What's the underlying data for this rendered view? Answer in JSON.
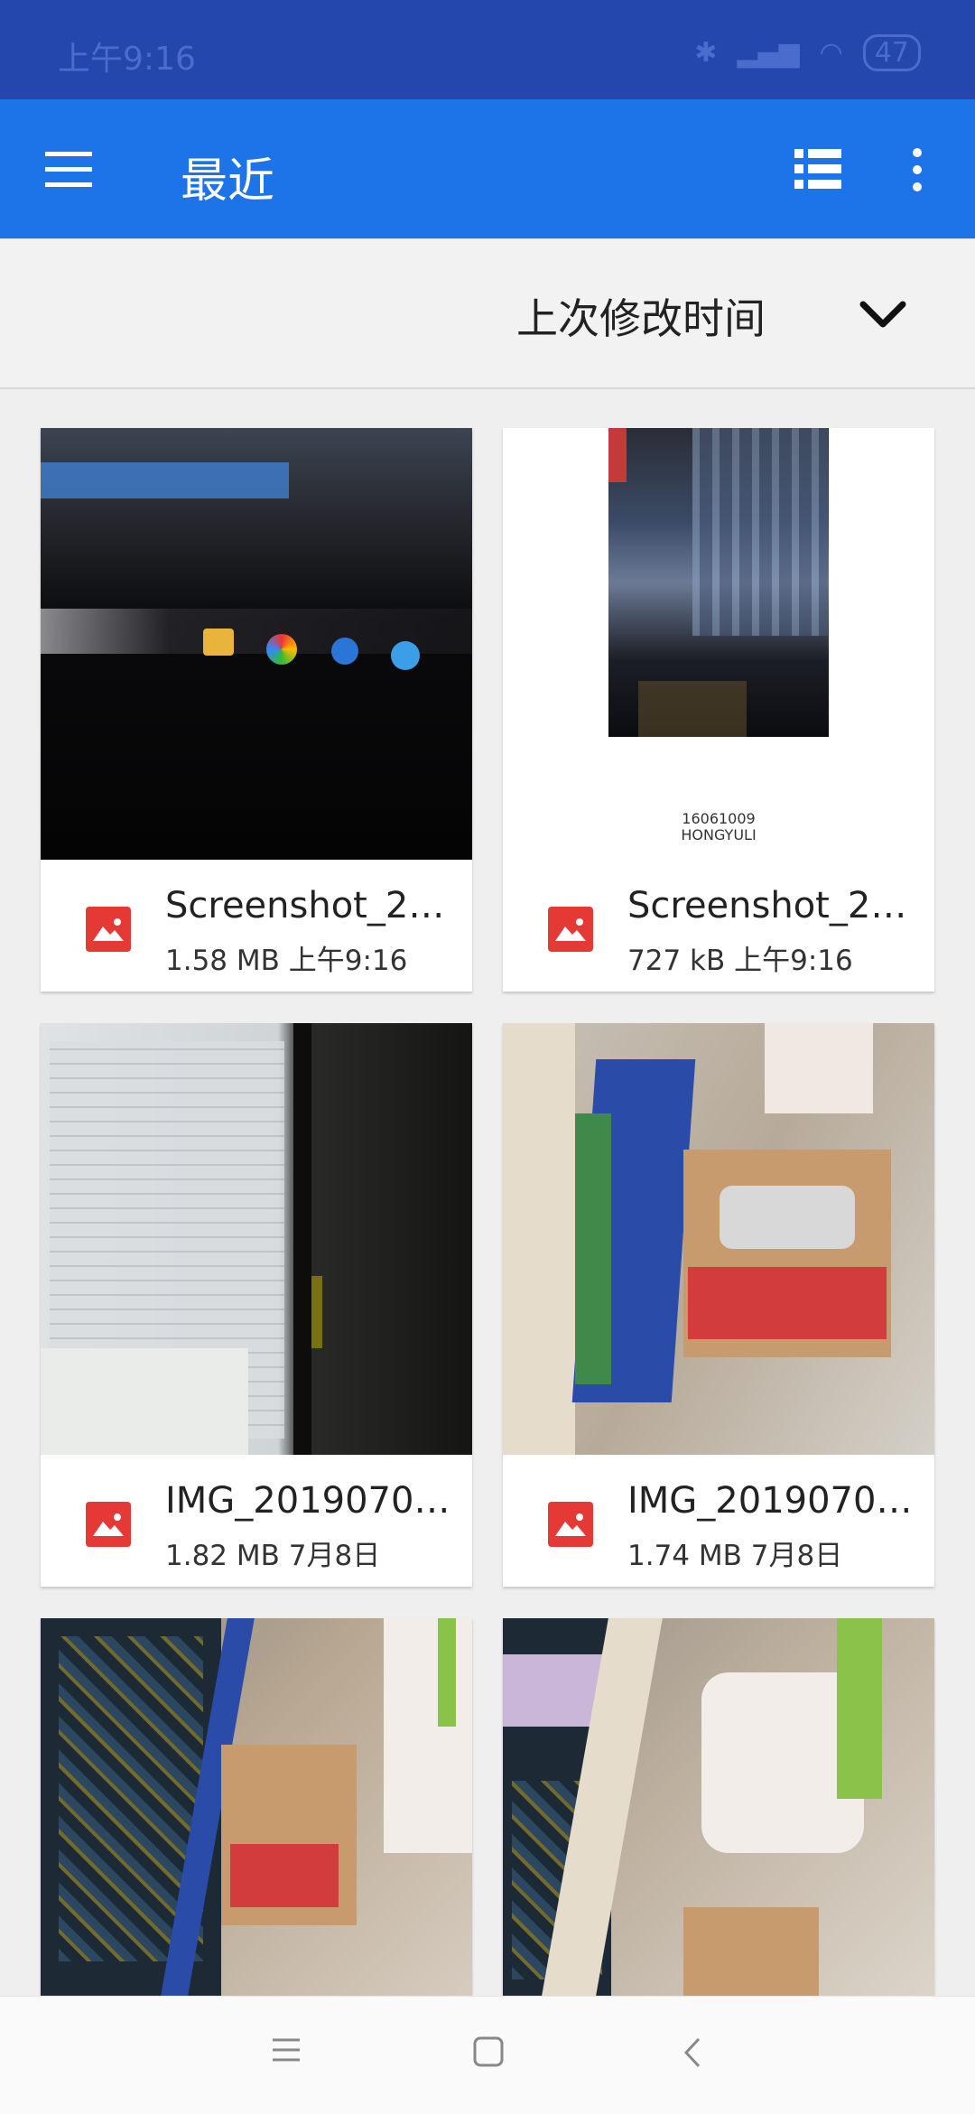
{
  "status_bar": {
    "time": "上午9:16",
    "battery": "47"
  },
  "app_bar": {
    "title": "最近"
  },
  "sort": {
    "label": "上次修改时间"
  },
  "files": [
    {
      "name": "Screenshot_2…",
      "size": "1.58 MB",
      "date": "上午9:16"
    },
    {
      "name": "Screenshot_2…",
      "size": "727 kB",
      "date": "上午9:16",
      "caption_line1": "16061009",
      "caption_line2": "HONGYULI"
    },
    {
      "name": "IMG_2019070…",
      "size": "1.82 MB",
      "date": "7月8日"
    },
    {
      "name": "IMG_2019070…",
      "size": "1.74 MB",
      "date": "7月8日"
    }
  ],
  "colors": {
    "status_bar": "#2447ad",
    "app_bar": "#1d73e8",
    "image_icon": "#e53935"
  },
  "icons": [
    "menu-icon",
    "list-view-icon",
    "more-vert-icon",
    "chevron-down-icon",
    "image-icon",
    "nav-menu-icon",
    "nav-home-icon",
    "nav-back-icon"
  ]
}
